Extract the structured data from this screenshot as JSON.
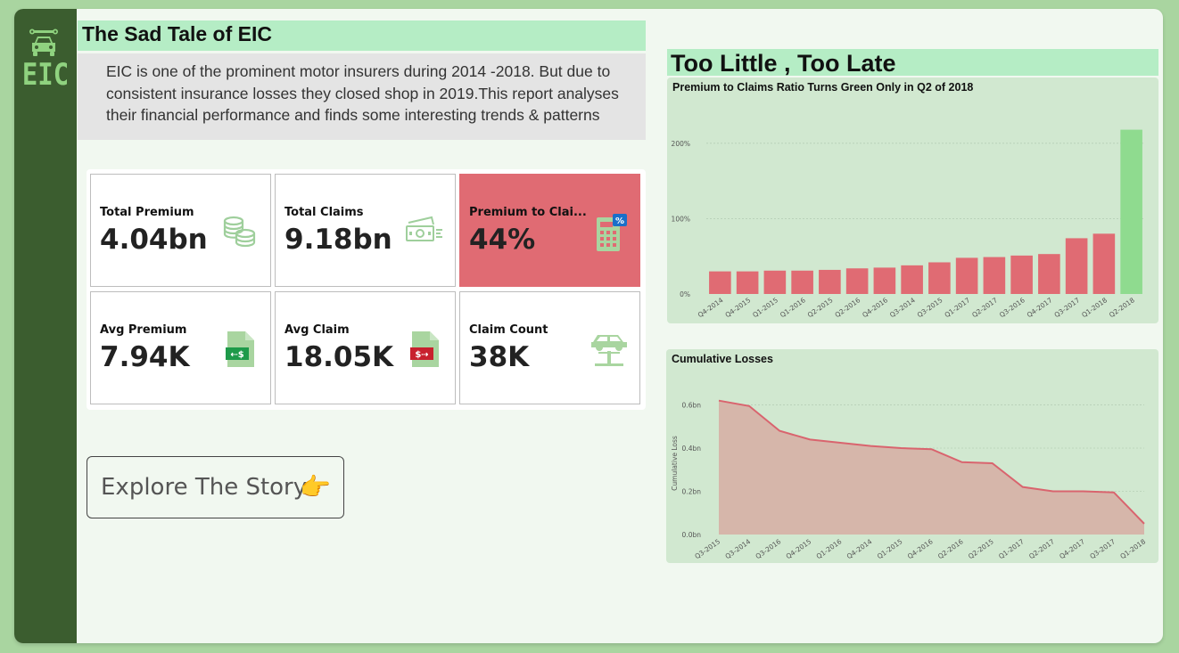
{
  "app": {
    "logo_text": "EIC",
    "logo_icon": "car-wrench-icon"
  },
  "header": {
    "title": "The Sad Tale of EIC",
    "intro": "EIC is one of the prominent motor insurers during 2014 -2018. But due to consistent insurance losses they closed shop in 2019.This report analyses their financial performance and finds some interesting trends & patterns"
  },
  "kpis": [
    {
      "label": "Total Premium",
      "value": "4.04bn",
      "icon": "coins-icon"
    },
    {
      "label": "Total Claims",
      "value": "9.18bn",
      "icon": "cash-bill-icon"
    },
    {
      "label": "Premium to Clai...",
      "value": "44%",
      "icon": "calculator-percent-icon"
    },
    {
      "label": "Avg Premium",
      "value": "7.94K",
      "icon": "document-dollar-in-icon"
    },
    {
      "label": "Avg Claim",
      "value": "18.05K",
      "icon": "document-dollar-out-icon"
    },
    {
      "label": "Claim Count",
      "value": "38K",
      "icon": "car-lift-icon"
    }
  ],
  "explore": {
    "label": "Explore The Story",
    "emoji": "👉"
  },
  "section_title": "Too Little , Too Late",
  "colors": {
    "sidebar": "#3b5d2f",
    "accent_green": "#8fdb8f",
    "loss_red": "#e06b73",
    "header_green": "#b5edc5",
    "chart_bg": "#d1e8d0"
  },
  "chart_data": [
    {
      "type": "bar",
      "title": "Premium to Claims Ratio Turns Green Only in Q2 of 2018",
      "xlabel": "",
      "ylabel": "",
      "categories": [
        "Q4-2014",
        "Q4-2015",
        "Q1-2015",
        "Q1-2016",
        "Q2-2015",
        "Q2-2016",
        "Q4-2016",
        "Q3-2014",
        "Q3-2015",
        "Q1-2017",
        "Q2-2017",
        "Q3-2016",
        "Q4-2017",
        "Q3-2017",
        "Q1-2018",
        "Q2-2018"
      ],
      "values": [
        30,
        30,
        31,
        31,
        32,
        34,
        35,
        38,
        42,
        48,
        49,
        51,
        53,
        74,
        80,
        218
      ],
      "bar_colors": [
        "#e06b73",
        "#e06b73",
        "#e06b73",
        "#e06b73",
        "#e06b73",
        "#e06b73",
        "#e06b73",
        "#e06b73",
        "#e06b73",
        "#e06b73",
        "#e06b73",
        "#e06b73",
        "#e06b73",
        "#e06b73",
        "#e06b73",
        "#8fdb8f"
      ],
      "ytick_labels": [
        "0%",
        "100%",
        "200%"
      ],
      "yticks": [
        0,
        100,
        200
      ],
      "ylim": [
        0,
        240
      ],
      "grid": true
    },
    {
      "type": "area",
      "title": "Cumulative Losses",
      "xlabel": "",
      "ylabel": "Cumulative Loss",
      "x": [
        "Q3-2015",
        "Q3-2014",
        "Q3-2016",
        "Q4-2015",
        "Q1-2016",
        "Q4-2014",
        "Q1-2015",
        "Q4-2016",
        "Q2-2016",
        "Q2-2015",
        "Q1-2017",
        "Q2-2017",
        "Q4-2017",
        "Q3-2017",
        "Q1-2018"
      ],
      "values": [
        0.62,
        0.595,
        0.48,
        0.44,
        0.425,
        0.41,
        0.4,
        0.395,
        0.335,
        0.33,
        0.22,
        0.2,
        0.2,
        0.195,
        0.05
      ],
      "ytick_labels": [
        "0.0bn",
        "0.2bn",
        "0.4bn",
        "0.6bn"
      ],
      "yticks": [
        0,
        0.2,
        0.4,
        0.6
      ],
      "ylim": [
        0,
        0.66
      ],
      "line_color": "#d9646e",
      "fill_color": "#d6b6aa",
      "grid": true
    }
  ]
}
